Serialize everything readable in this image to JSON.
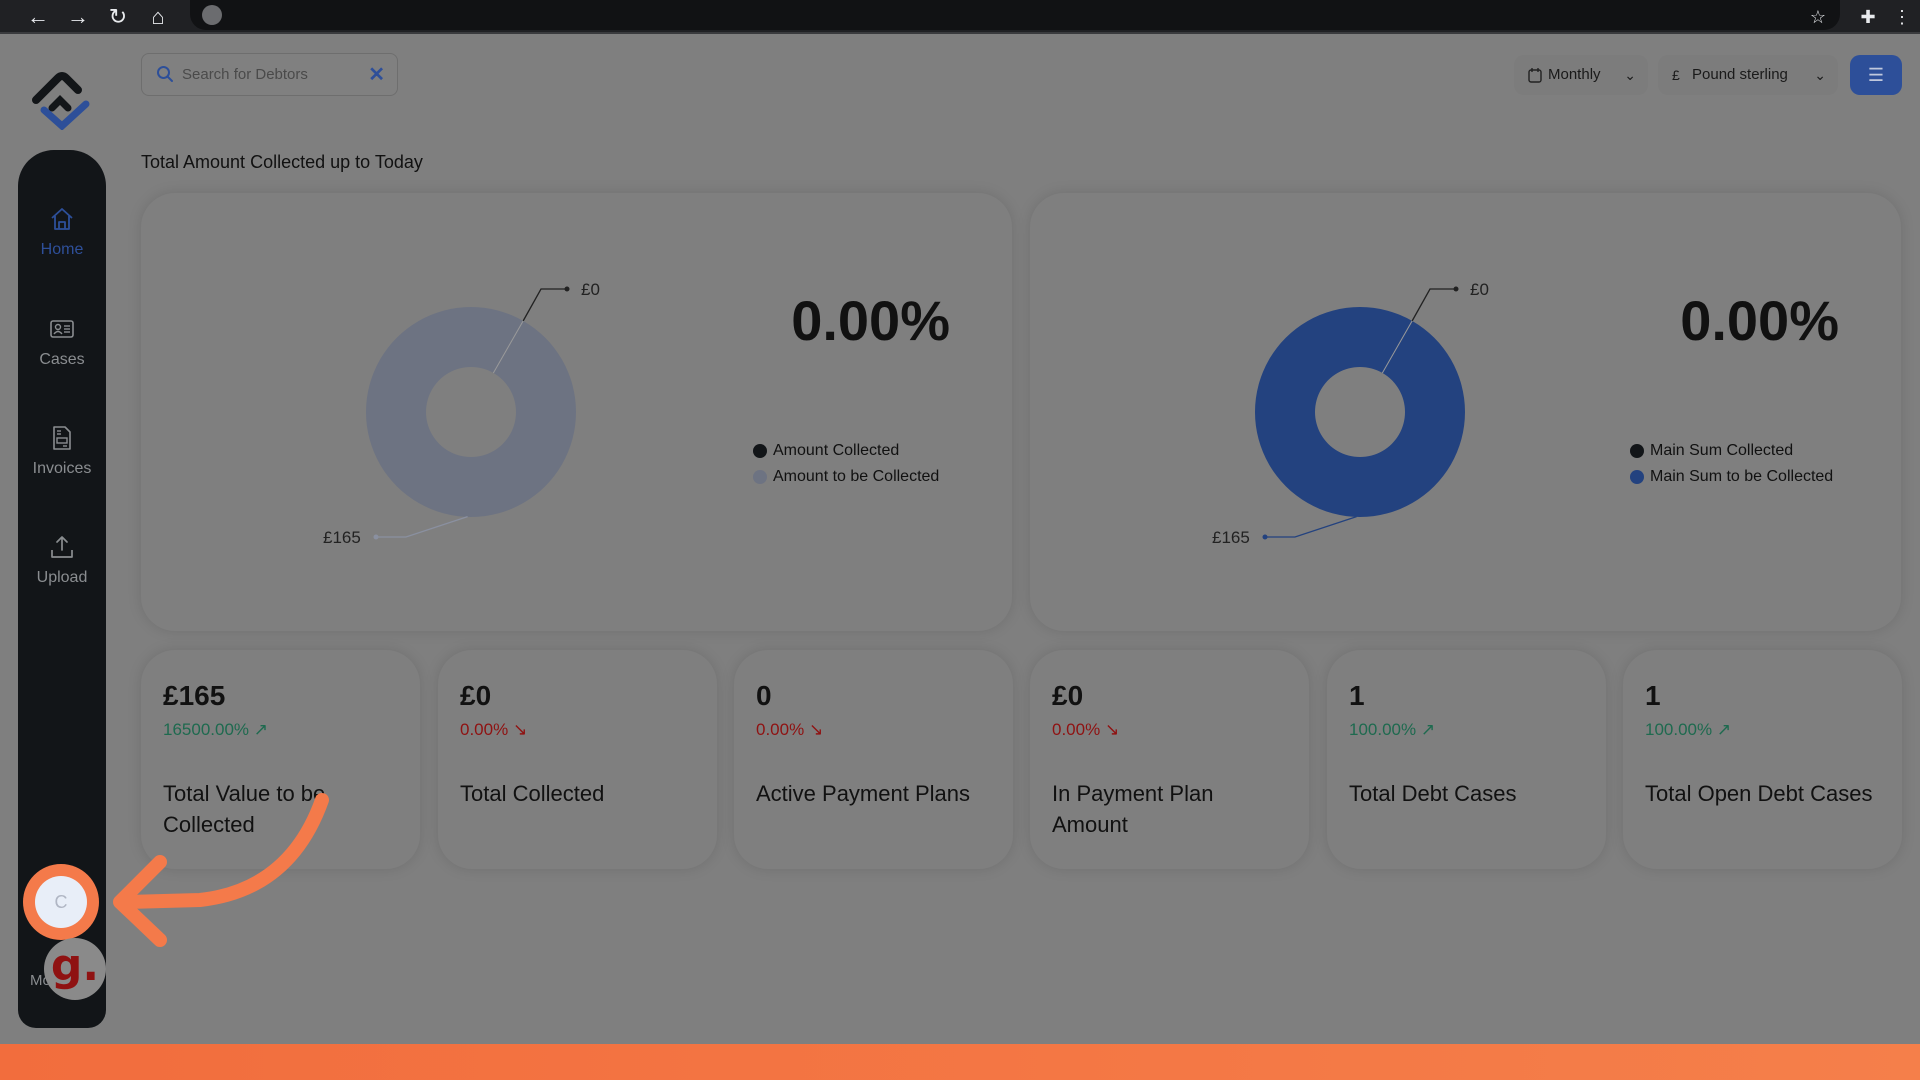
{
  "browser": {
    "back_icon": "←",
    "forward_icon": "→",
    "reload_icon": "↻",
    "home_icon": "⌂",
    "bookmark_icon": "☆",
    "extensions_icon": "✚",
    "menu_icon": "⋮"
  },
  "search": {
    "placeholder": "Search for Debtors",
    "value": "",
    "clear_icon": "✕"
  },
  "toolbar": {
    "period": {
      "icon": "📅",
      "label": "Monthly",
      "chevron": "⌄"
    },
    "currency": {
      "icon": "£",
      "label": "Pound sterling",
      "chevron": "⌄"
    },
    "filter_icon": "☰"
  },
  "sidebar": {
    "items": [
      {
        "label": "Home",
        "icon": "home-icon",
        "active": true
      },
      {
        "label": "Cases",
        "icon": "id-card-icon",
        "active": false
      },
      {
        "label": "Invoices",
        "icon": "invoice-icon",
        "active": false
      },
      {
        "label": "Upload",
        "icon": "upload-icon",
        "active": false
      }
    ],
    "avatar_initial": "C",
    "bottom_text": "Mo"
  },
  "section_title": "Total Amount Collected up to Today",
  "chart_data": [
    {
      "type": "pie",
      "variant": "donut",
      "title": "Amount Collected",
      "percentage_label": "0.00%",
      "labels": [
        "Amount Collected",
        "Amount to be Collected"
      ],
      "values": [
        0,
        165
      ],
      "value_labels": [
        "£0",
        "£165"
      ],
      "colors": [
        "#121518",
        "#6d7382"
      ],
      "legend": "right"
    },
    {
      "type": "pie",
      "variant": "donut",
      "title": "Main Sum Collected",
      "percentage_label": "0.00%",
      "labels": [
        "Main Sum Collected",
        "Main Sum to be Collected"
      ],
      "values": [
        0,
        165
      ],
      "value_labels": [
        "£0",
        "£165"
      ],
      "colors": [
        "#121518",
        "#23427f"
      ],
      "legend": "right"
    }
  ],
  "stats": [
    {
      "value": "£165",
      "change": "16500.00%",
      "trend": "up",
      "label": "Total Value to be Collected"
    },
    {
      "value": "£0",
      "change": "0.00%",
      "trend": "down",
      "label": "Total Collected"
    },
    {
      "value": "0",
      "change": "0.00%",
      "trend": "down",
      "label": "Active Payment Plans"
    },
    {
      "value": "£0",
      "change": "0.00%",
      "trend": "down",
      "label": "In Payment Plan Amount"
    },
    {
      "value": "1",
      "change": "100.00%",
      "trend": "up",
      "label": "Total Debt Cases"
    },
    {
      "value": "1",
      "change": "100.00%",
      "trend": "up",
      "label": "Total Open Debt Cases"
    }
  ],
  "colors": {
    "accent": "#2d4f99",
    "trend_up": "#1e6a4f",
    "trend_down": "#8f1212",
    "annotation": "#f47a4a",
    "sidebar_bg": "#121518"
  },
  "trend_icons": {
    "up": "↗",
    "down": "↘"
  }
}
